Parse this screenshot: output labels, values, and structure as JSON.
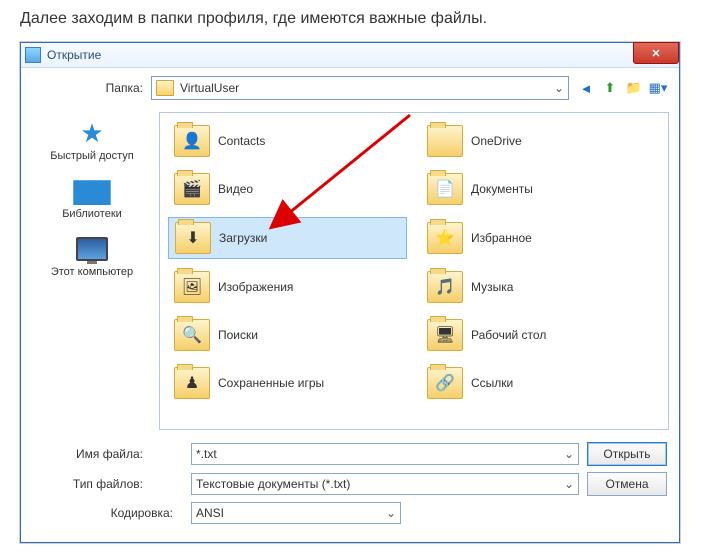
{
  "caption": "Далее заходим в папки профиля, где имеются важные файлы.",
  "dialog": {
    "title": "Открытие",
    "folder_label": "Папка:",
    "current_folder": "VirtualUser",
    "filename_label": "Имя файла:",
    "filename_value": "*.txt",
    "filetype_label": "Тип файлов:",
    "filetype_value": "Текстовые документы (*.txt)",
    "encoding_label": "Кодировка:",
    "encoding_value": "ANSI",
    "open_button": "Открыть",
    "cancel_button": "Отмена"
  },
  "sidebar": {
    "quickaccess": "Быстрый доступ",
    "libraries": "Библиотеки",
    "thispc": "Этот компьютер"
  },
  "folders": {
    "left": [
      {
        "label": "Contacts",
        "overlay": "👤"
      },
      {
        "label": "Видео",
        "overlay": "🎬"
      },
      {
        "label": "Загрузки",
        "overlay": "⬇",
        "selected": true
      },
      {
        "label": "Изображения",
        "overlay": "🖼"
      },
      {
        "label": "Поиски",
        "overlay": "🔍"
      },
      {
        "label": "Сохраненные игры",
        "overlay": "♟"
      }
    ],
    "right": [
      {
        "label": "OneDrive",
        "overlay": ""
      },
      {
        "label": "Документы",
        "overlay": "📄"
      },
      {
        "label": "Избранное",
        "overlay": "⭐"
      },
      {
        "label": "Музыка",
        "overlay": "🎵"
      },
      {
        "label": "Рабочий стол",
        "overlay": "🖥"
      },
      {
        "label": "Ссылки",
        "overlay": "🔗"
      }
    ]
  }
}
